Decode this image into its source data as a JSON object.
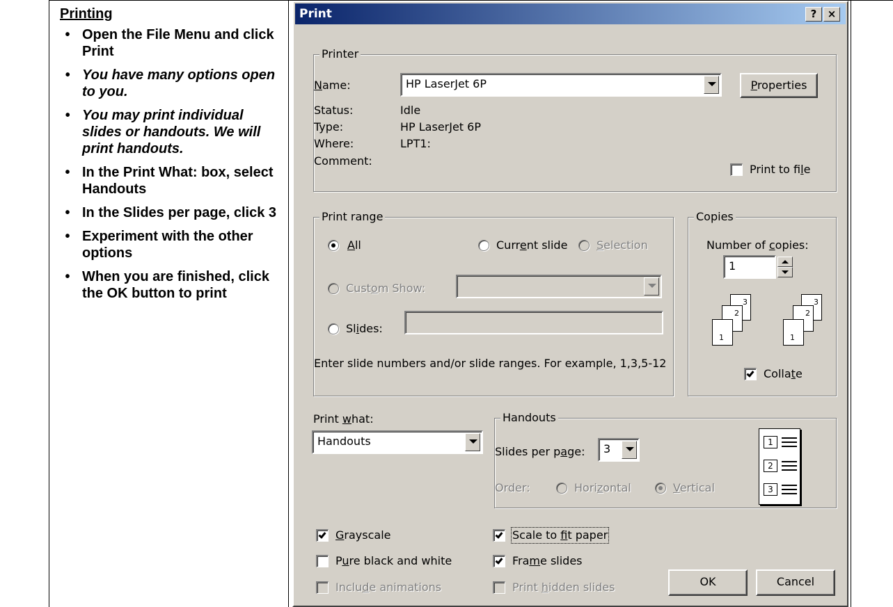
{
  "instructions": {
    "heading": "Printing",
    "bullets": [
      {
        "text": "Open the File Menu and click Print",
        "italic": false
      },
      {
        "text": "You have many options open to you.",
        "italic": true
      },
      {
        "text": "You may print individual slides or handouts. We will print handouts.",
        "italic": true
      },
      {
        "text": "In the Print What: box, select Handouts",
        "italic": false
      },
      {
        "text": "In the Slides per page, click 3",
        "italic": false
      },
      {
        "text": "Experiment with the other options",
        "italic": false
      },
      {
        "text": "When you are finished, click the OK button to print",
        "italic": false
      }
    ]
  },
  "dialog": {
    "title": "Print",
    "help_glyph": "?",
    "close_glyph": "×",
    "printer": {
      "group_label": "Printer",
      "name_label": "Name:",
      "name_value": "HP LaserJet 6P",
      "properties_button": "Properties",
      "status_label": "Status:",
      "status_value": "Idle",
      "type_label": "Type:",
      "type_value": "HP LaserJet 6P",
      "where_label": "Where:",
      "where_value": "LPT1:",
      "comment_label": "Comment:",
      "print_to_file": "Print to file"
    },
    "print_range": {
      "group_label": "Print range",
      "all": "All",
      "current_slide": "Current slide",
      "selection": "Selection",
      "custom_show": "Custom Show:",
      "slides": "Slides:",
      "hint": "Enter slide numbers and/or slide ranges. For example, 1,3,5-12"
    },
    "copies": {
      "group_label": "Copies",
      "number_label": "Number of copies:",
      "number_value": "1",
      "collate": "Collate",
      "page_numbers": [
        "1",
        "2",
        "3"
      ]
    },
    "print_what": {
      "label": "Print what:",
      "value": "Handouts"
    },
    "handouts": {
      "group_label": "Handouts",
      "slides_per_page_label": "Slides per page:",
      "slides_per_page_value": "3",
      "order_label": "Order:",
      "horizontal": "Horizontal",
      "vertical": "Vertical",
      "layout_numbers": [
        "1",
        "2",
        "3"
      ]
    },
    "options": {
      "grayscale": "Grayscale",
      "pure_bw": "Pure black and white",
      "include_animations": "Include animations",
      "scale_to_fit": "Scale to fit paper",
      "frame_slides": "Frame slides",
      "print_hidden": "Print hidden slides"
    },
    "ok_button": "OK",
    "cancel_button": "Cancel"
  }
}
